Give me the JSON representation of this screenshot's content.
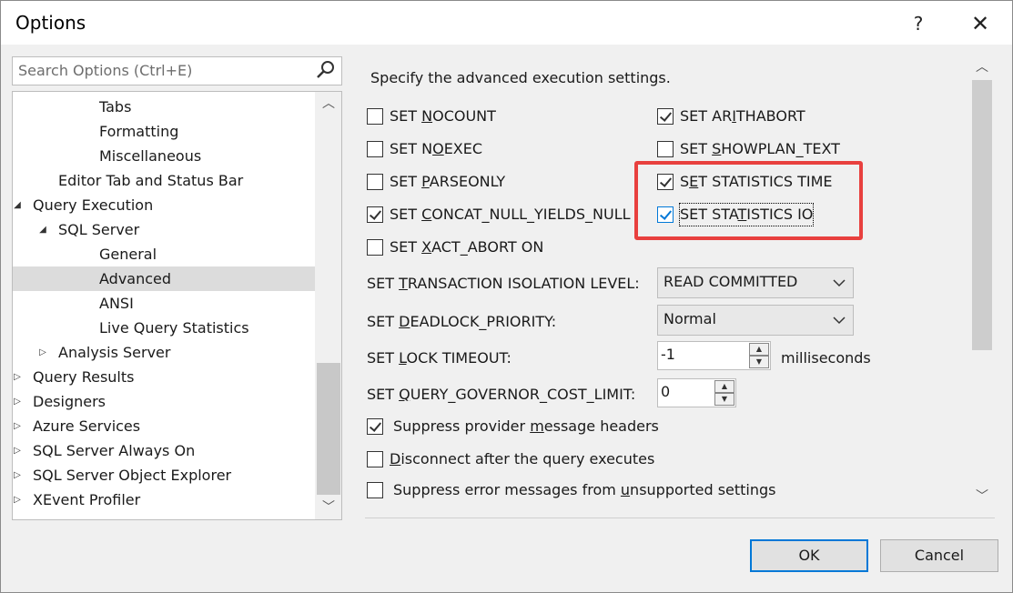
{
  "window": {
    "title": "Options",
    "help_label": "?",
    "close_label": "✕"
  },
  "search": {
    "placeholder": "Search Options (Ctrl+E)"
  },
  "tree": {
    "items": [
      {
        "label": "Tabs",
        "indent": 3,
        "arrow": ""
      },
      {
        "label": "Formatting",
        "indent": 3,
        "arrow": ""
      },
      {
        "label": "Miscellaneous",
        "indent": 3,
        "arrow": ""
      },
      {
        "label": "Editor Tab and Status Bar",
        "indent": 2,
        "arrow": ""
      },
      {
        "label": "Query Execution",
        "indent": 1,
        "arrow": "expanded"
      },
      {
        "label": "SQL Server",
        "indent": 2,
        "arrow": "expanded"
      },
      {
        "label": "General",
        "indent": 3,
        "arrow": ""
      },
      {
        "label": "Advanced",
        "indent": 3,
        "arrow": "",
        "selected": true
      },
      {
        "label": "ANSI",
        "indent": 3,
        "arrow": ""
      },
      {
        "label": "Live Query Statistics",
        "indent": 3,
        "arrow": ""
      },
      {
        "label": "Analysis Server",
        "indent": 2,
        "arrow": "collapsed"
      },
      {
        "label": "Query Results",
        "indent": 1,
        "arrow": "collapsed"
      },
      {
        "label": "Designers",
        "indent": 1,
        "arrow": "collapsed"
      },
      {
        "label": "Azure Services",
        "indent": 1,
        "arrow": "collapsed"
      },
      {
        "label": "SQL Server Always On",
        "indent": 1,
        "arrow": "collapsed"
      },
      {
        "label": "SQL Server Object Explorer",
        "indent": 1,
        "arrow": "collapsed"
      },
      {
        "label": "XEvent Profiler",
        "indent": 1,
        "arrow": "collapsed"
      }
    ]
  },
  "settings": {
    "heading": "Specify the advanced execution settings.",
    "checkboxes_left": [
      {
        "pre": "SET ",
        "ul": "N",
        "post": "OCOUNT",
        "checked": false
      },
      {
        "pre": "SET N",
        "ul": "O",
        "post": "EXEC",
        "checked": false
      },
      {
        "pre": "SET ",
        "ul": "P",
        "post": "ARSEONLY",
        "checked": false
      },
      {
        "pre": "SET ",
        "ul": "C",
        "post": "ONCAT_NULL_YIELDS_NULL",
        "checked": true
      },
      {
        "pre": "SET ",
        "ul": "X",
        "post": "ACT_ABORT ON",
        "checked": false
      }
    ],
    "checkboxes_right": [
      {
        "pre": "SET AR",
        "ul": "I",
        "post": "THABORT",
        "checked": true
      },
      {
        "pre": "SET ",
        "ul": "S",
        "post": "HOWPLAN_TEXT",
        "checked": false
      },
      {
        "pre": "S",
        "ul": "E",
        "post": "T STATISTICS TIME",
        "checked": true
      },
      {
        "pre": "SET STA",
        "ul": "T",
        "post": "ISTICS IO",
        "checked": true
      }
    ],
    "isolation_label": {
      "pre": "SET ",
      "ul": "T",
      "post": "RANSACTION ISOLATION LEVEL:"
    },
    "isolation_value": "READ COMMITTED",
    "deadlock_label": {
      "pre": "SET ",
      "ul": "D",
      "post": "EADLOCK_PRIORITY:"
    },
    "deadlock_value": "Normal",
    "lock_label": {
      "pre": "SET ",
      "ul": "L",
      "post": "OCK TIMEOUT:"
    },
    "lock_value": "-1",
    "lock_unit": "milliseconds",
    "governor_label": {
      "pre": "SET ",
      "ul": "Q",
      "post": "UERY_GOVERNOR_COST_LIMIT:"
    },
    "governor_value": "0",
    "bottom_checks": [
      {
        "pre": "Suppress provider ",
        "ul": "m",
        "post": "essage headers",
        "checked": true
      },
      {
        "pre": "",
        "ul": "D",
        "post": "isconnect after the query executes",
        "checked": false
      },
      {
        "pre": "Suppress error messages from ",
        "ul": "u",
        "post": "nsupported settings",
        "checked": false
      }
    ]
  },
  "buttons": {
    "ok": "OK",
    "cancel": "Cancel"
  },
  "colors": {
    "highlight": "#e8403e",
    "accent": "#0078d7",
    "selection": "#dcdcdc"
  }
}
